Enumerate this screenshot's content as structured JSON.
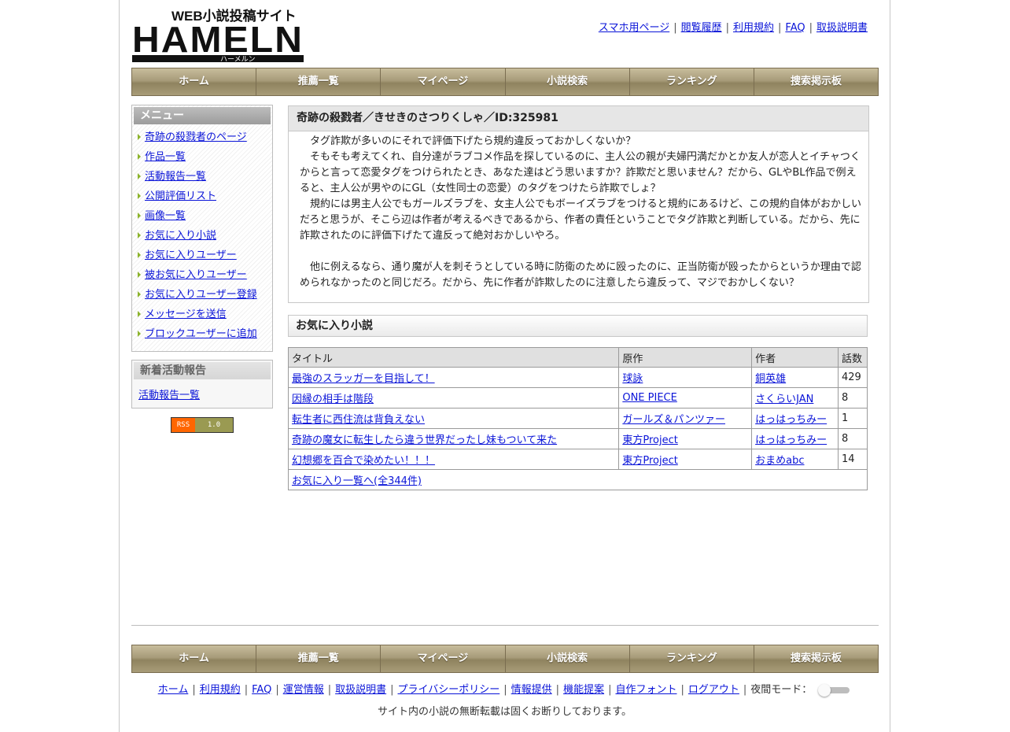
{
  "logo": {
    "tagline": "WEB小説投稿サイト",
    "wordmark": "HAMELN",
    "kana": "ハーメルン"
  },
  "top_links": [
    "スマホ用ページ",
    "閲覧履歴",
    "利用規約",
    "FAQ",
    "取扱説明書"
  ],
  "nav": [
    "ホーム",
    "推薦一覧",
    "マイページ",
    "小説検索",
    "ランキング",
    "捜索掲示板"
  ],
  "sidebar": {
    "menu_title": "メニュー",
    "menu": [
      "奇跡の殺戮者のページ",
      "作品一覧",
      "活動報告一覧",
      "公開評価リスト",
      "画像一覧",
      "お気に入り小説",
      "お気に入りユーザー",
      "被お気に入りユーザー",
      "お気に入りユーザー登録",
      "メッセージを送信",
      "ブロックユーザーに追加"
    ],
    "news_title": "新着活動報告",
    "news_link": "活動報告一覧",
    "rss_left": "RSS",
    "rss_right": "1.0"
  },
  "profile": {
    "title": "奇跡の殺戮者／きせきのさつりくしゃ／ID:325981",
    "paragraphs": [
      "タグ詐欺が多いのにそれで評価下げたら規約違反っておかしくないか？",
      "そもそも考えてくれ、自分達がラブコメ作品を探しているのに、主人公の親が夫婦円満だかとか友人が恋人とイチャつくからと言って恋愛タグをつけられたとき、あなた達はどう思いますか？詐欺だと思いません？だから、GLやBL作品で例えると、主人公が男やのにGL（女性同士の恋愛）のタグをつけたら詐欺でしょ？",
      "規約には男主人公でもガールズラブを、女主人公でもボーイズラブをつけると規約にあるけど、この規約自体がおかしいだろと思うが、そこら辺は作者が考えるべきであるから、作者の責任ということでタグ詐欺と判断している。だから、先に詐欺されたのに評価下げたて違反って絶対おかしいやろ。",
      "",
      "他に例えるなら、通り魔が人を刺そうとしている時に防衛のために殴ったのに、正当防衛が殴ったからというか理由で認められなかったのと同じだろ。だから、先に作者が詐欺したのに注意したら違反って、マジでおかしくない？"
    ]
  },
  "favorites": {
    "heading": "お気に入り小説",
    "columns": [
      "タイトル",
      "原作",
      "作者",
      "話数"
    ],
    "rows": [
      {
        "title": "最強のスラッガーを目指して！",
        "origin": "球詠",
        "author": "銅英雄",
        "episodes": "429"
      },
      {
        "title": "因縁の相手は階段",
        "origin": "ONE PIECE",
        "author": "さくらいJAN",
        "episodes": "8"
      },
      {
        "title": "転生者に西住流は背負えない",
        "origin": "ガールズ＆パンツァー",
        "author": "はっはっちみー",
        "episodes": "1"
      },
      {
        "title": "奇跡の魔女に転生したら違う世界だったし妹もついて来た",
        "origin": "東方Project",
        "author": "はっはっちみー",
        "episodes": "8"
      },
      {
        "title": "幻想郷を百合で染めたい！！！",
        "origin": "東方Project",
        "author": "おまめabc",
        "episodes": "14"
      }
    ],
    "more_link": "お気に入り一覧へ(全344件)"
  },
  "footer": {
    "links": [
      "ホーム",
      "利用規約",
      "FAQ",
      "運営情報",
      "取扱説明書",
      "プライバシーポリシー",
      "情報提供",
      "機能提案",
      "自作フォント",
      "ログアウト"
    ],
    "night_mode_label": "夜間モード：",
    "note": "サイト内の小説の無断転載は固くお断りしております。"
  },
  "colors": {
    "link": "#0a14d8",
    "nav_gold": "#a79b7a",
    "menu_arrow": "#8cb32b"
  }
}
